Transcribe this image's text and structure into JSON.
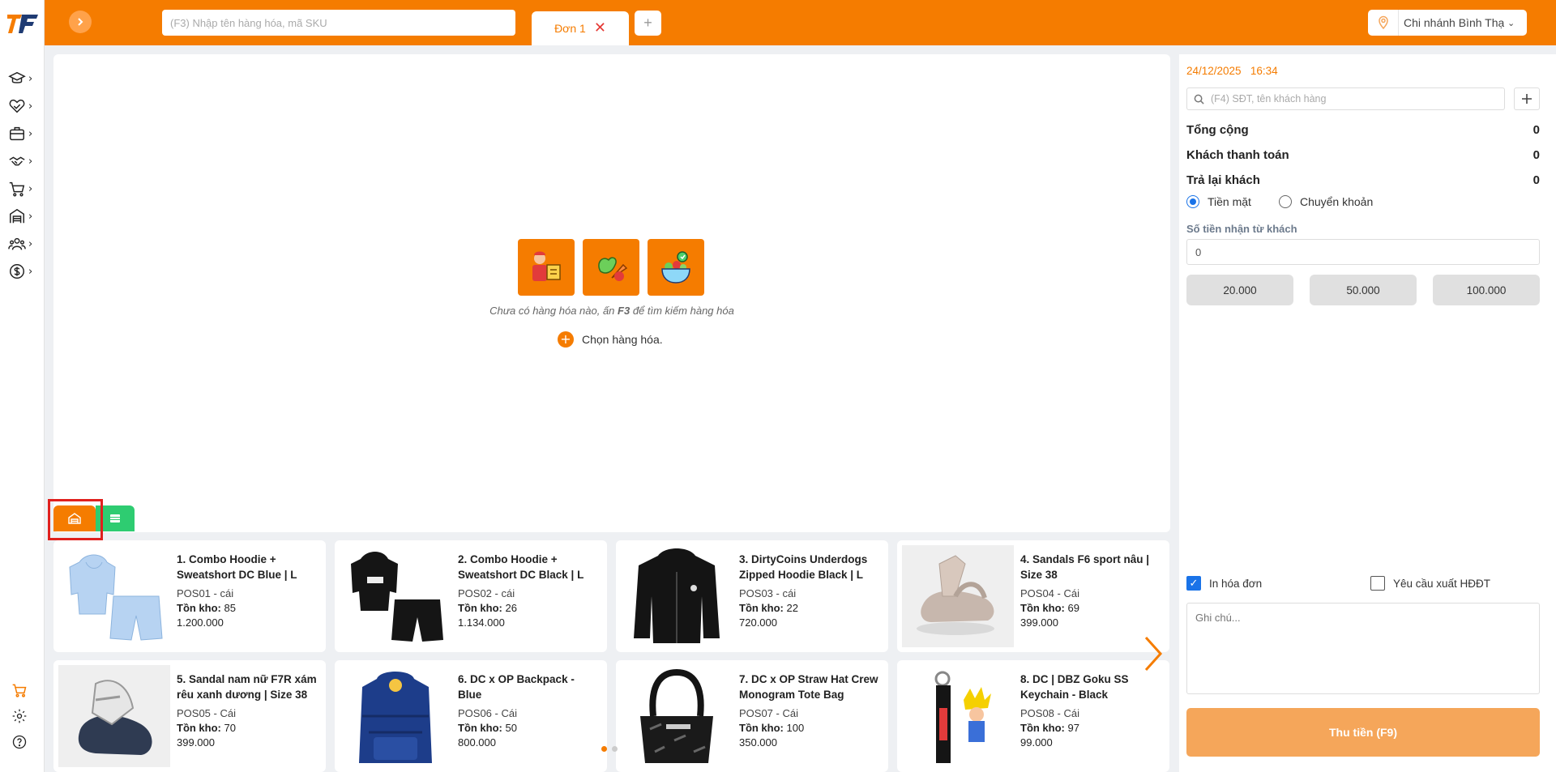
{
  "header": {
    "search_placeholder": "(F3) Nhập tên hàng hóa, mã SKU",
    "tab_label": "Đơn 1",
    "tab_add": "+",
    "branch_name": "Chi nhánh Bình Thạnh"
  },
  "sidebar": {
    "items": [
      {
        "icon": "graduation-cap-icon"
      },
      {
        "icon": "handshake-heart-icon"
      },
      {
        "icon": "briefcase-icon"
      },
      {
        "icon": "handshake-icon"
      },
      {
        "icon": "shopping-cart-icon"
      },
      {
        "icon": "warehouse-icon"
      },
      {
        "icon": "users-icon"
      },
      {
        "icon": "dollar-coin-icon"
      }
    ],
    "bottom": [
      "cart-icon",
      "gear-icon",
      "help-icon"
    ]
  },
  "empty_state": {
    "text_before": "Chưa có hàng hóa nào, ấn ",
    "text_key": "F3",
    "text_after": " để tìm kiếm hàng hóa",
    "choose_label": "Chọn hàng hóa."
  },
  "products": [
    {
      "name": "1. Combo Hoodie + Sweatshort DC Blue | L",
      "sku": "POS01 - cái",
      "stock_label": "Tồn kho:",
      "stock": "85",
      "price": "1.200.000"
    },
    {
      "name": "2. Combo Hoodie + Sweatshort DC Black | L",
      "sku": "POS02 - cái",
      "stock_label": "Tồn kho:",
      "stock": "26",
      "price": "1.134.000"
    },
    {
      "name": "3. DirtyCoins Underdogs Zipped Hoodie Black | L",
      "sku": "POS03 - cái",
      "stock_label": "Tồn kho:",
      "stock": "22",
      "price": "720.000"
    },
    {
      "name": "4. Sandals F6 sport nâu | Size 38",
      "sku": "POS04 - Cái",
      "stock_label": "Tồn kho:",
      "stock": "69",
      "price": "399.000"
    },
    {
      "name": "5. Sandal nam nữ F7R xám rêu xanh dương | Size 38",
      "sku": "POS05 - Cái",
      "stock_label": "Tồn kho:",
      "stock": "70",
      "price": "399.000"
    },
    {
      "name": "6. DC x OP Backpack - Blue",
      "sku": "POS06 - Cái",
      "stock_label": "Tồn kho:",
      "stock": "50",
      "price": "800.000"
    },
    {
      "name": "7. DC x OP Straw Hat Crew Monogram Tote Bag",
      "sku": "POS07 - Cái",
      "stock_label": "Tồn kho:",
      "stock": "100",
      "price": "350.000"
    },
    {
      "name": "8. DC | DBZ Goku SS Keychain - Black",
      "sku": "POS08 - Cái",
      "stock_label": "Tồn kho:",
      "stock": "97",
      "price": "99.000"
    }
  ],
  "order": {
    "date": "24/12/2025",
    "time": "16:34",
    "customer_placeholder": "(F4) SĐT, tên khách hàng",
    "total_label": "Tổng cộng",
    "total_value": "0",
    "paid_label": "Khách thanh toán",
    "paid_value": "0",
    "change_label": "Trả lại khách",
    "change_value": "0",
    "method_cash": "Tiền mặt",
    "method_transfer": "Chuyển khoản",
    "received_label": "Số tiền nhận từ khách",
    "received_value": "0",
    "quick_amounts": [
      "20.000",
      "50.000",
      "100.000"
    ],
    "print_label": "In hóa đơn",
    "einvoice_label": "Yêu cầu xuất HĐĐT",
    "note_placeholder": "Ghi chú...",
    "pay_button": "Thu tiền (F9)"
  },
  "colors": {
    "brand": "#f57c00",
    "pay_button": "#f5a65a",
    "list_view": "#2ecc71"
  }
}
